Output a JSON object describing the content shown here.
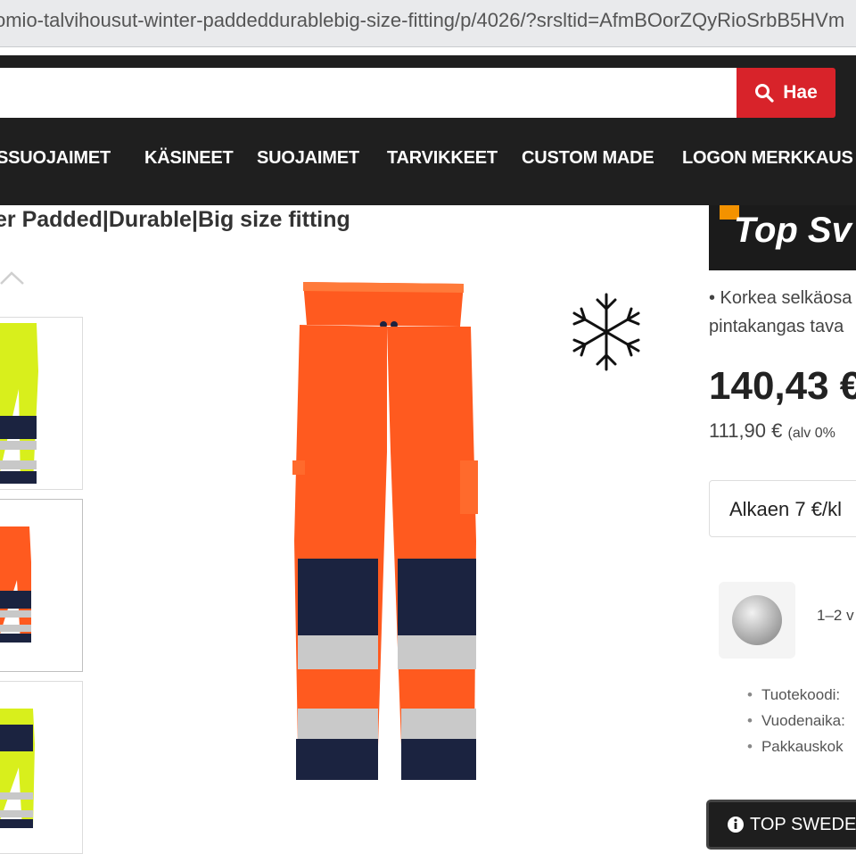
{
  "browser": {
    "url": "omio-talvihousut-winter-paddeddurablebig-size-fitting/p/4026/?srsltid=AfmBOorZQyRioSrbB5HVm"
  },
  "search": {
    "button_label": "Hae",
    "placeholder": ""
  },
  "nav": {
    "items": [
      "SSUOJAIMET",
      "KÄSINEET",
      "SUOJAIMET",
      "TARVIKKEET",
      "CUSTOM MADE",
      "LOGON MERKKAUS"
    ]
  },
  "product": {
    "title": "er Padded|Durable|Big size fitting",
    "description_line1": "• Korkea selkäosa",
    "description_line2": "pintakangas tava",
    "price": "140,43 €",
    "price_ex_vat": "111,90 €",
    "vat_note": "(alv 0%",
    "shipping": "Alkaen 7 €/kl",
    "delivery_time": "1–2 v",
    "specs": [
      "Tuotekoodi:",
      "Vuodenaika:",
      "Pakkauskok"
    ],
    "brand_logo": "Top Sv",
    "brand_button": "TOP SWEDE"
  },
  "colors": {
    "accent_red": "#d8232a",
    "header_dark": "#1f1f1f",
    "hivis_orange": "#ff5a1f",
    "hivis_yellow": "#d8ef1c",
    "navy": "#1b2340"
  },
  "icons": [
    "search-icon",
    "chevron-up-icon",
    "snowflake-icon",
    "info-icon",
    "color-swatch-icon"
  ]
}
